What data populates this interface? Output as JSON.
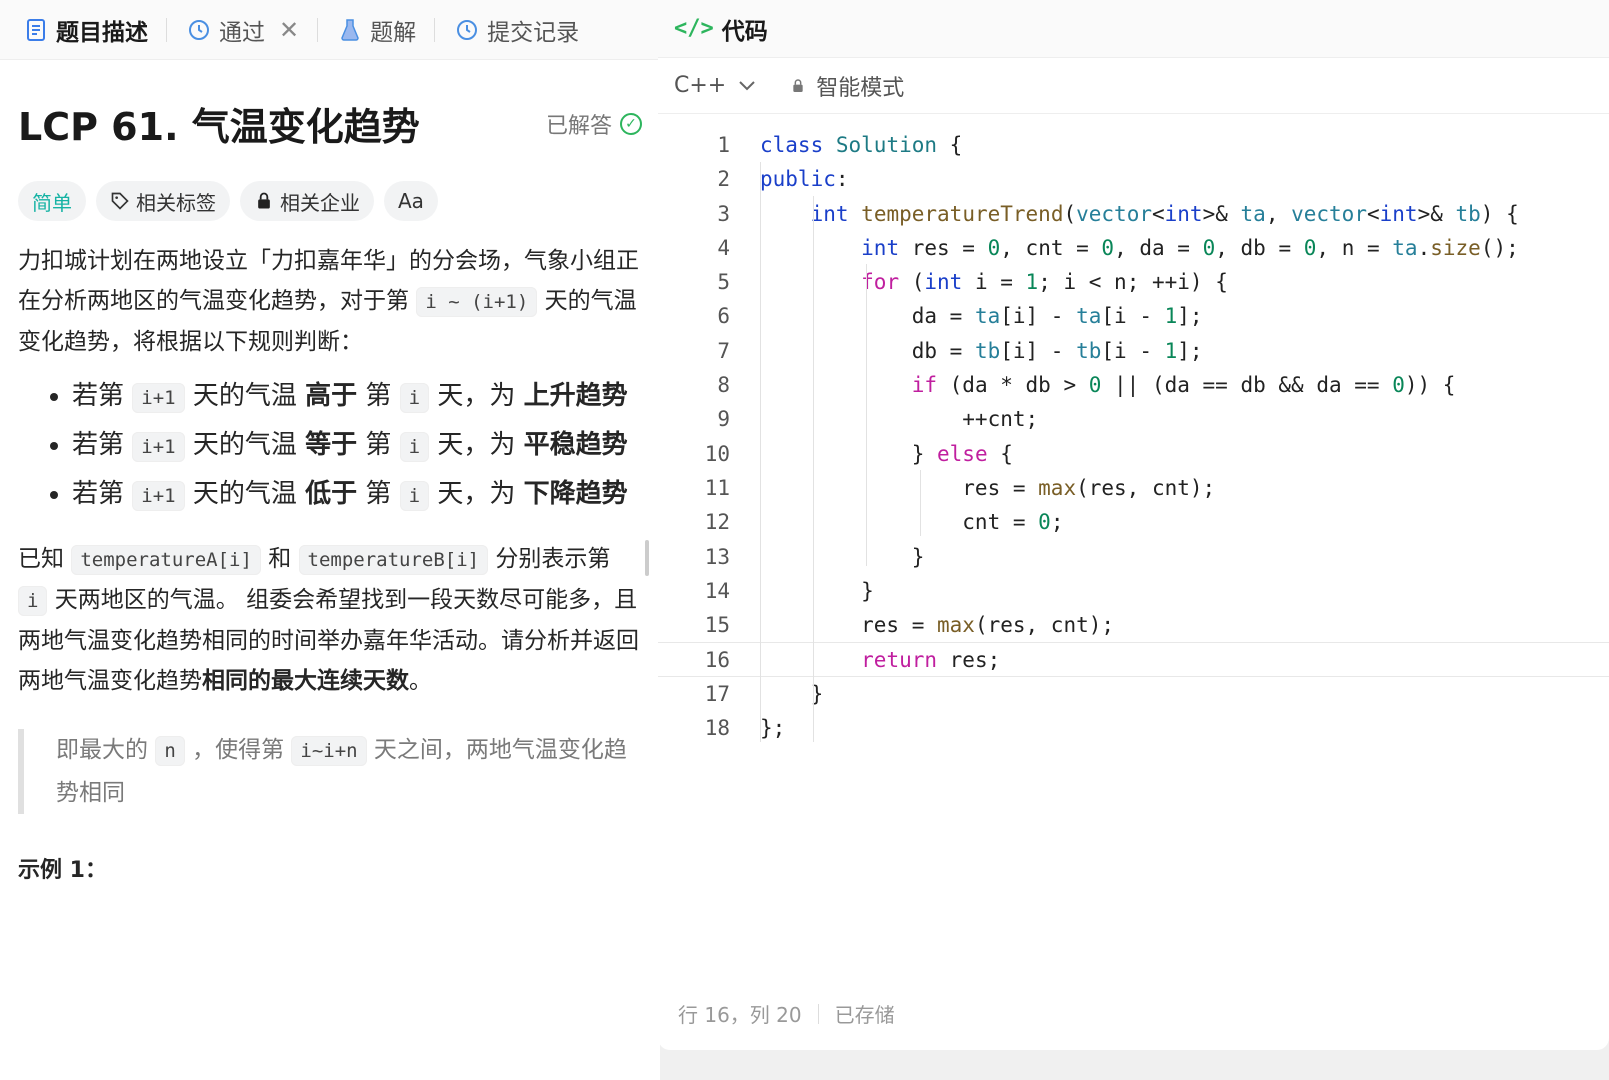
{
  "tabs": [
    {
      "label": "题目描述",
      "icon": "document-icon",
      "active": true
    },
    {
      "label": "通过",
      "icon": "history-icon",
      "closable": true
    },
    {
      "label": "题解",
      "icon": "flask-icon"
    },
    {
      "label": "提交记录",
      "icon": "history-icon"
    }
  ],
  "problem": {
    "title": "LCP 61. 气温变化趋势",
    "status": "已解答",
    "difficulty": "简单",
    "tags_label": "相关标签",
    "companies_label": "相关企业",
    "font_label": "Aa",
    "para1_a": "力扣城计划在两地设立「力扣嘉年华」的分会场，气象小组正在分析两地区的气温变化趋势，对于第 ",
    "para1_code": "i ~ (i+1)",
    "para1_b": " 天的气温变化趋势，将根据以下规则判断：",
    "rules": [
      {
        "a": "若第 ",
        "code": "i+1",
        "b": " 天的气温 ",
        "bold1": "高于",
        "c": " 第 ",
        "code2": "i",
        "d": " 天，为 ",
        "bold2": "上升趋势"
      },
      {
        "a": "若第 ",
        "code": "i+1",
        "b": " 天的气温 ",
        "bold1": "等于",
        "c": " 第 ",
        "code2": "i",
        "d": " 天，为 ",
        "bold2": "平稳趋势"
      },
      {
        "a": "若第 ",
        "code": "i+1",
        "b": " 天的气温 ",
        "bold1": "低于",
        "c": " 第 ",
        "code2": "i",
        "d": " 天，为 ",
        "bold2": "下降趋势"
      }
    ],
    "para2_a": "已知 ",
    "para2_code1": "temperatureA[i]",
    "para2_b": " 和 ",
    "para2_code2": "temperatureB[i]",
    "para2_c": " 分别表示第 ",
    "para2_code3": "i",
    "para2_d": " 天两地区的气温。 组委会希望找到一段天数尽可能多，且两地气温变化趋势相同的时间举办嘉年华活动。请分析并返回两地气温变化趋势",
    "para2_bold": "相同的最大连续天数",
    "para2_e": "。",
    "quote_a": "即最大的 ",
    "quote_code1": "n",
    "quote_b": " ，使得第 ",
    "quote_code2": "i~i+n",
    "quote_c": " 天之间，两地气温变化趋势相同",
    "example": "示例 1："
  },
  "editor": {
    "header": "代码",
    "language": "C++",
    "mode": "智能模式",
    "status_pos": "行 16，列 20",
    "status_saved": "已存储",
    "current_line": 16
  }
}
